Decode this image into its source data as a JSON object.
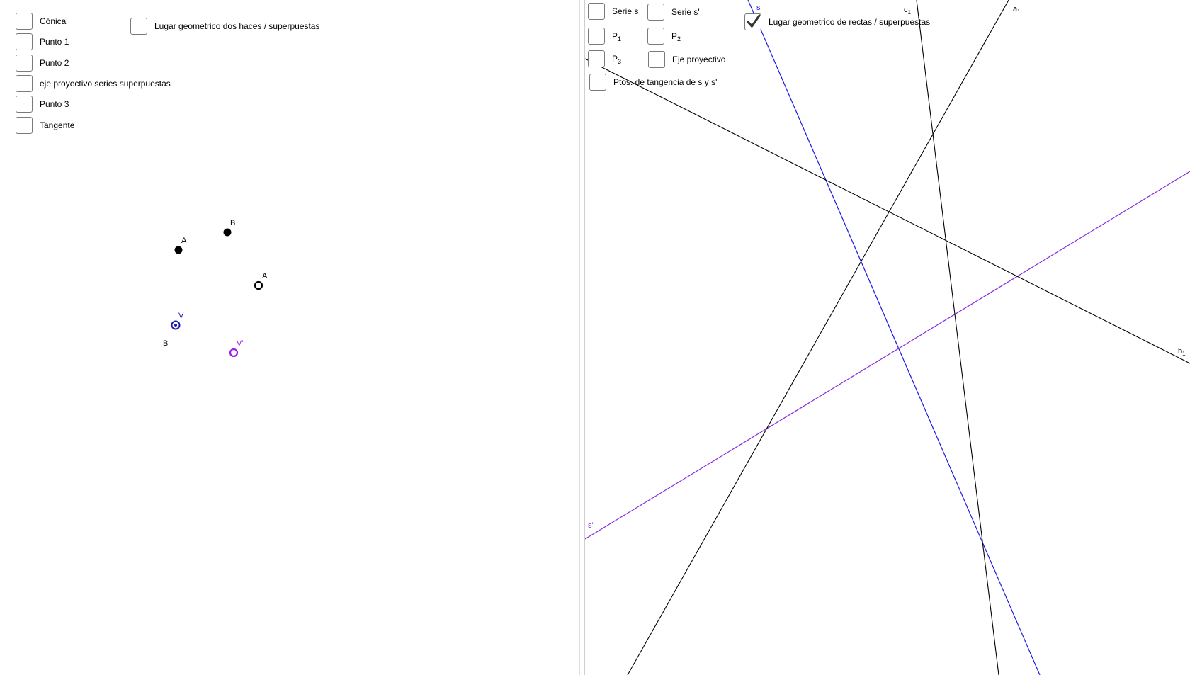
{
  "left_view": {
    "checkboxes": [
      {
        "label": "Cónica",
        "checked": false
      },
      {
        "label": "Punto 1",
        "checked": false
      },
      {
        "label": "Punto 2",
        "checked": false
      },
      {
        "label": "eje proyectivo series superpuestas",
        "checked": false
      },
      {
        "label": "Punto 3",
        "checked": false
      },
      {
        "label": "Tangente",
        "checked": false
      },
      {
        "label": "Lugar geometrico dos haces / superpuestas",
        "checked": false
      }
    ],
    "points": [
      {
        "name": "A",
        "style": "filled",
        "color": "#000000"
      },
      {
        "name": "B",
        "style": "filled",
        "color": "#000000"
      },
      {
        "name": "A'",
        "style": "ring",
        "color": "#000000"
      },
      {
        "name": "V",
        "style": "ring-dot",
        "color": "#1a1aa8"
      },
      {
        "name": "B'",
        "style": "label-only",
        "color": "#000000"
      },
      {
        "name": "V'",
        "style": "ring",
        "color": "#9a1fe0"
      }
    ]
  },
  "right_view": {
    "checkboxes": [
      {
        "label": "Serie s",
        "checked": false
      },
      {
        "label": "Serie s'",
        "checked": false
      },
      {
        "label_main": "P",
        "label_sub": "1",
        "checked": false
      },
      {
        "label_main": "P",
        "label_sub": "2",
        "checked": false
      },
      {
        "label_main": "P",
        "label_sub": "3",
        "checked": false
      },
      {
        "label": "Eje proyectivo",
        "checked": false
      },
      {
        "label": "Ptos. de tangencia de s y s'",
        "checked": false
      },
      {
        "label": "Lugar geometrico de rectas / superpuestas",
        "checked": true
      }
    ],
    "lines": [
      {
        "name": "s",
        "main": "s",
        "sub": "",
        "color": "#1a1ae6"
      },
      {
        "name": "s'",
        "main": "s'",
        "sub": "",
        "color": "#8a2be2"
      },
      {
        "name": "a1",
        "main": "a",
        "sub": "1",
        "color": "#000000"
      },
      {
        "name": "b1",
        "main": "b",
        "sub": "1",
        "color": "#000000"
      },
      {
        "name": "c1",
        "main": "c",
        "sub": "1",
        "color": "#000000"
      }
    ]
  },
  "colors": {
    "blue": "#1a1ae6",
    "purple": "#8a2be2",
    "black": "#000000"
  }
}
